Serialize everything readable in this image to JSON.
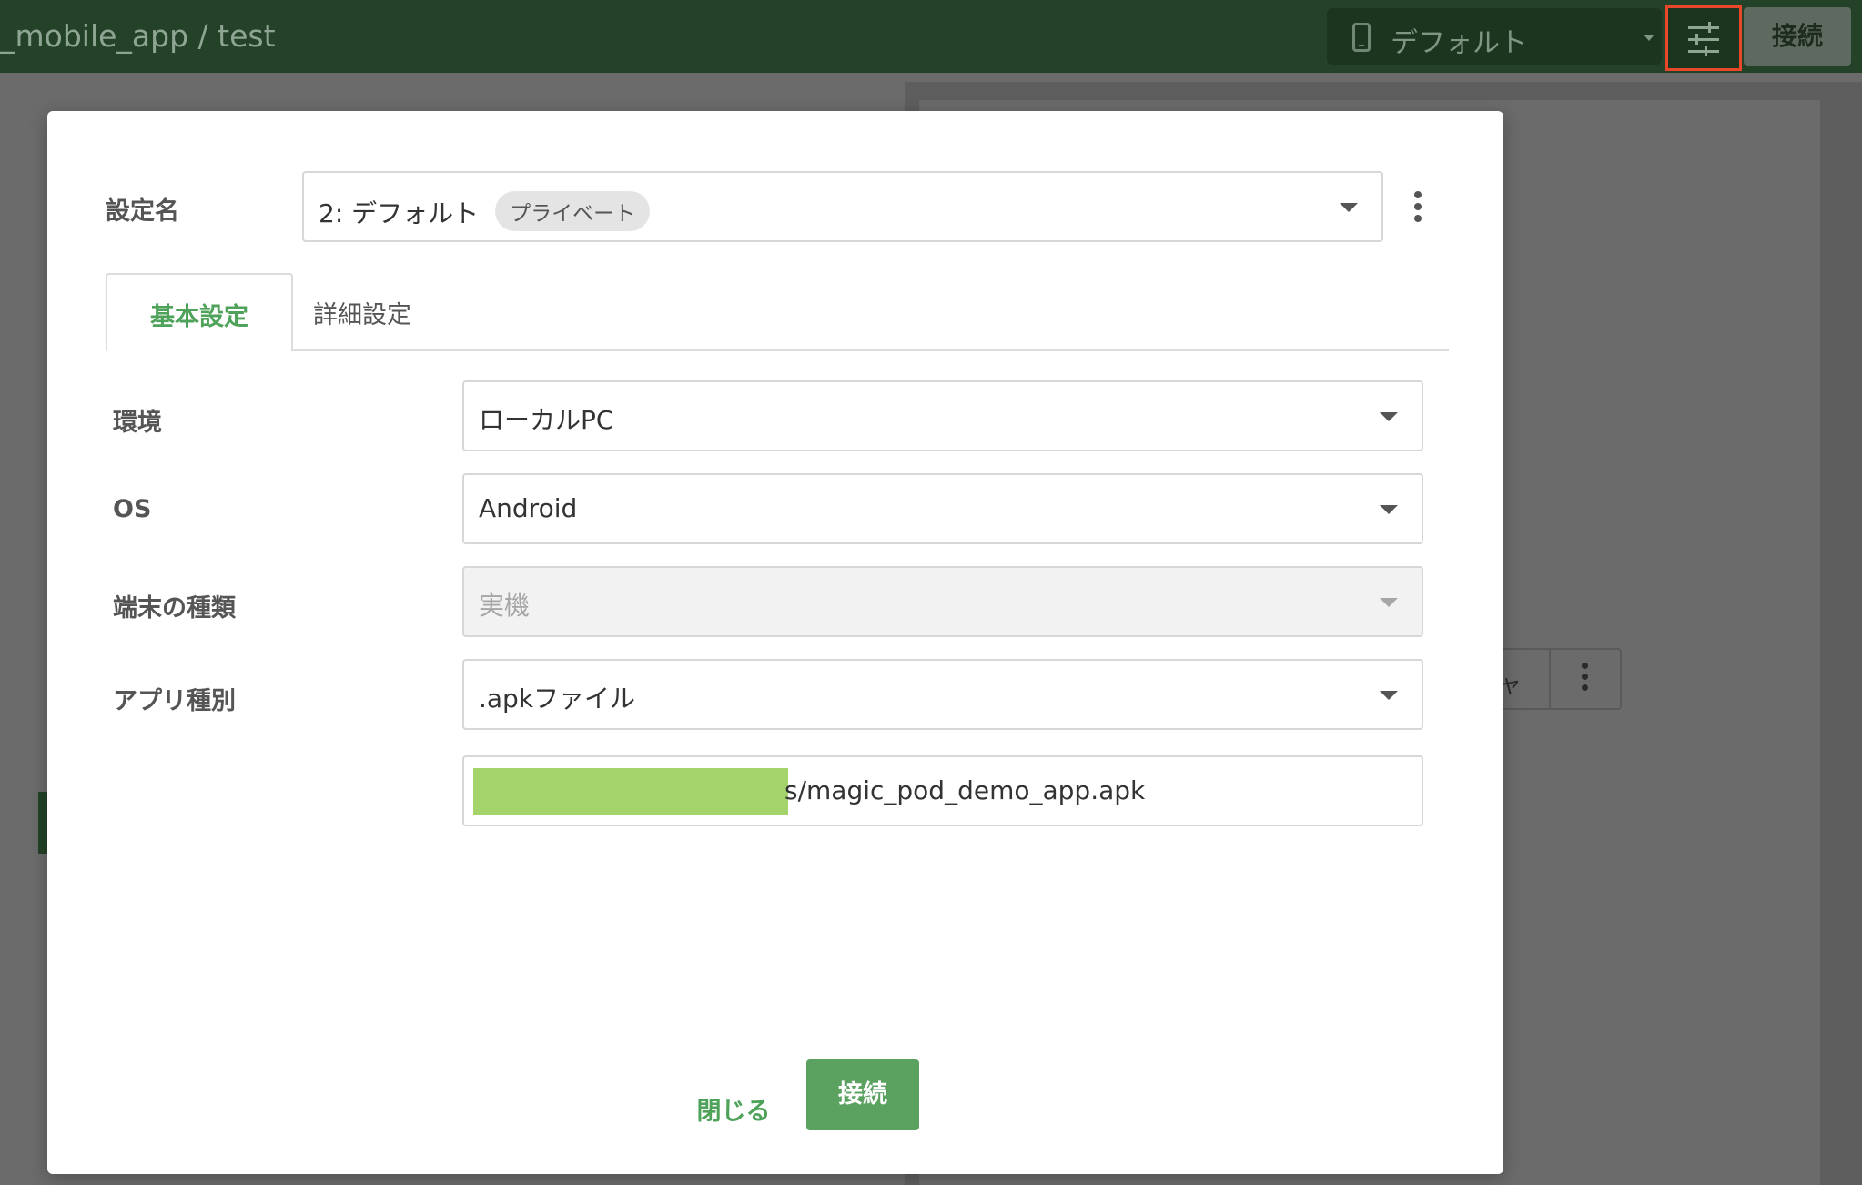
{
  "header": {
    "breadcrumb": "_mobile_app / test",
    "device_select": {
      "value": "デフォルト",
      "icon": "phone-icon"
    },
    "settings_icon": "sliders-icon",
    "connect_label": "接続"
  },
  "background": {
    "button_fragment": "ャ"
  },
  "modal": {
    "config_name_label": "設定名",
    "config_name_value": "2: デフォルト",
    "config_badge": "プライベート",
    "tabs": [
      {
        "label": "基本設定",
        "active": true
      },
      {
        "label": "詳細設定",
        "active": false
      }
    ],
    "fields": {
      "environment": {
        "label": "環境",
        "value": "ローカルPC"
      },
      "os": {
        "label": "OS",
        "value": "Android"
      },
      "device_type": {
        "label": "端末の種類",
        "value": "実機",
        "disabled": true
      },
      "app_type": {
        "label": "アプリ種別",
        "value": ".apkファイル"
      },
      "app_path": {
        "value": "s/magic_pod_demo_app.apk"
      }
    },
    "close_label": "閉じる",
    "connect_label": "接続"
  },
  "colors": {
    "topbar": "#234227",
    "accent_green": "#5ba160",
    "highlight_red": "#e8472b",
    "redaction": "#a5d36b"
  }
}
